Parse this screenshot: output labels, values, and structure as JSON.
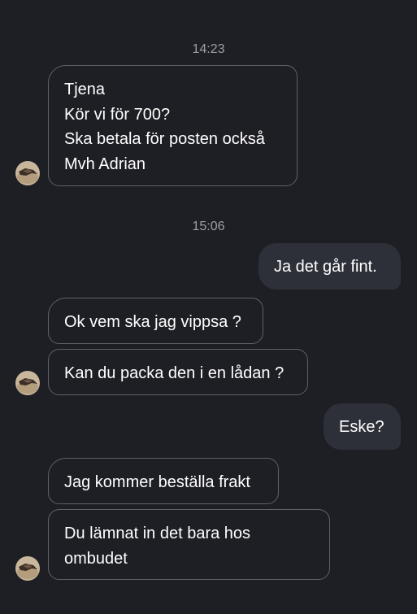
{
  "top_fragment": "",
  "timestamps": [
    "14:23",
    "15:06"
  ],
  "messages": {
    "m1": [
      "Tjena",
      "Kör vi för 700?",
      "Ska betala för posten också",
      "Mvh Adrian"
    ],
    "m2": "Ja det går fint.",
    "m3": "Ok vem ska jag vippsa ?",
    "m4": "Kan du packa den i en lådan ?",
    "m5": "Eske?",
    "m6": "Jag kommer beställa frakt",
    "m7": [
      "Du lämnat in det bara hos",
      "ombudet"
    ]
  },
  "icons": {
    "avatar": "contact-avatar"
  },
  "colors": {
    "background": "#1e1f25",
    "incoming_border": "#5e616b",
    "outgoing_bubble": "#2d3039",
    "timestamp": "#9da0a8",
    "text": "#ffffff"
  }
}
